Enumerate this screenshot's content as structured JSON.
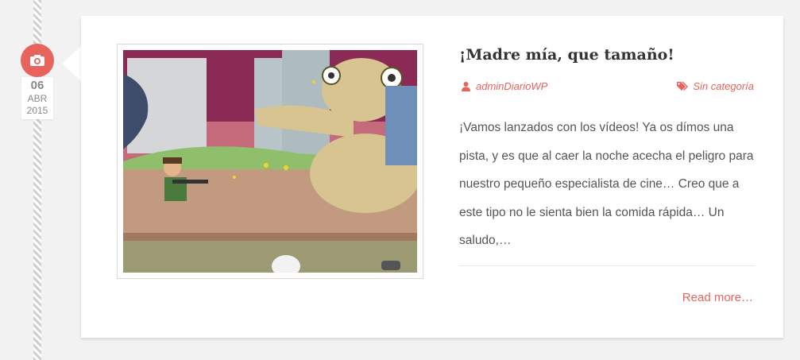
{
  "date": {
    "day": "06",
    "month": "ABR",
    "year": "2015",
    "icon": "camera-icon"
  },
  "post": {
    "title": "¡Madre mía, que tamaño!",
    "author": "adminDiarioWP",
    "category": "Sin categoría",
    "excerpt": "¡Vamos lanzados con los vídeos! Ya os dímos una pista, y es que al caer la noche acecha el peligro para nuestro pequeño especialista de cine… Creo que a este tipo no le sienta bien la comida rápida… Un saludo,…",
    "read_more": "Read more…",
    "thumbnail_description": "cartoon-game-scene"
  },
  "colors": {
    "accent": "#e7635c",
    "background": "#f2f2f2",
    "card": "#ffffff"
  }
}
